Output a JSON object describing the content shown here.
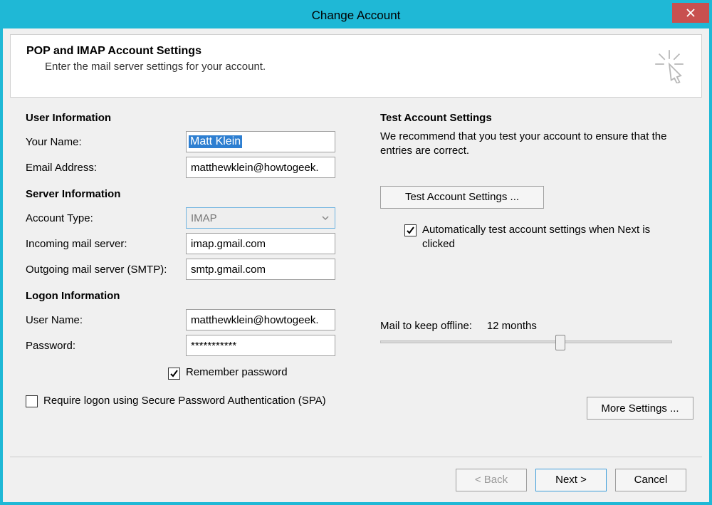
{
  "window": {
    "title": "Change Account"
  },
  "header": {
    "title": "POP and IMAP Account Settings",
    "subtitle": "Enter the mail server settings for your account."
  },
  "left": {
    "user_info_heading": "User Information",
    "your_name_label": "Your Name:",
    "your_name_value": "Matt Klein",
    "email_label": "Email Address:",
    "email_value": "matthewklein@howtogeek.",
    "server_info_heading": "Server Information",
    "account_type_label": "Account Type:",
    "account_type_value": "IMAP",
    "incoming_label": "Incoming mail server:",
    "incoming_value": "imap.gmail.com",
    "outgoing_label": "Outgoing mail server (SMTP):",
    "outgoing_value": "smtp.gmail.com",
    "logon_info_heading": "Logon Information",
    "username_label": "User Name:",
    "username_value": "matthewklein@howtogeek.",
    "password_label": "Password:",
    "password_value": "***********",
    "remember_password_label": "Remember password",
    "spa_label": "Require logon using Secure Password Authentication (SPA)"
  },
  "right": {
    "test_heading": "Test Account Settings",
    "test_desc": "We recommend that you test your account to ensure that the entries are correct.",
    "test_button": "Test Account Settings ...",
    "auto_test_label": "Automatically test account settings when Next is clicked",
    "mail_offline_label": "Mail to keep offline:",
    "mail_offline_value": "12 months",
    "more_settings": "More Settings ..."
  },
  "footer": {
    "back": "< Back",
    "next": "Next >",
    "cancel": "Cancel"
  },
  "checkboxes": {
    "remember_password": true,
    "spa": false,
    "auto_test": true
  }
}
